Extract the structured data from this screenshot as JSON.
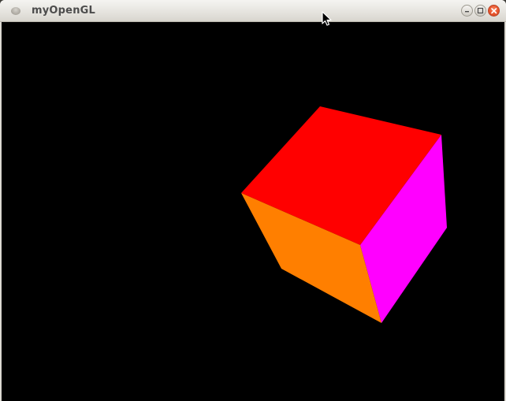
{
  "window": {
    "title": "myOpenGL",
    "controls": [
      {
        "name": "minimize",
        "icon": "minus-icon"
      },
      {
        "name": "maximize",
        "icon": "square-icon"
      },
      {
        "name": "close",
        "icon": "x-icon"
      }
    ]
  },
  "scene": {
    "background": "#000000",
    "cube": {
      "top_face_color": "#ff0000",
      "side_face_color": "#ff00ff",
      "front_face_color": "#ff7f00"
    }
  },
  "colors": {
    "titlebar_text": "#4c4c4c",
    "close_button": "#e9542c"
  }
}
